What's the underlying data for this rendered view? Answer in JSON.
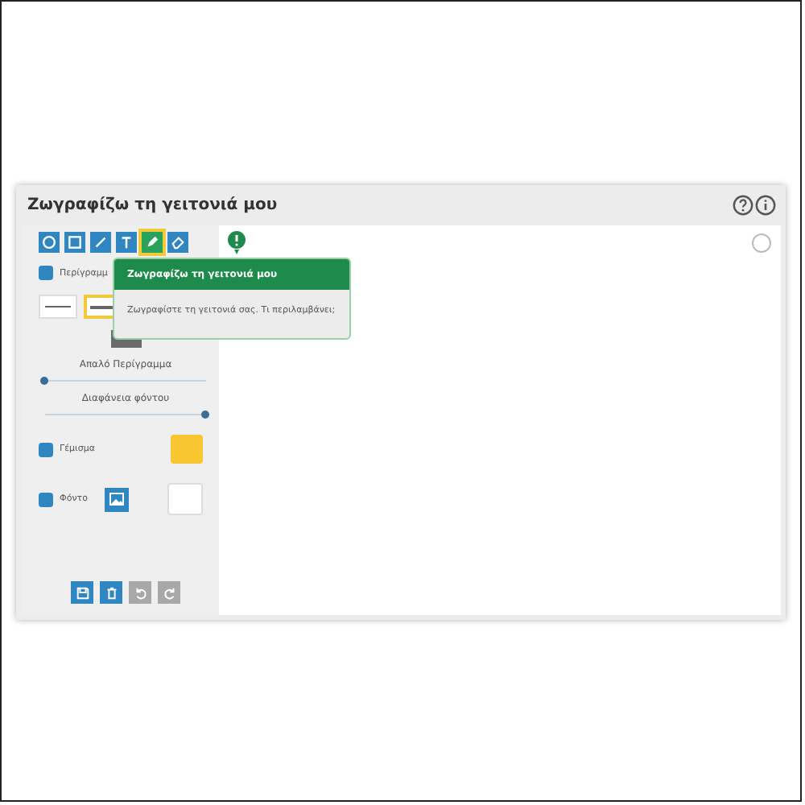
{
  "window": {
    "title": "Ζωγραφίζω τη γειτονιά μου"
  },
  "tools": [
    {
      "kind": "circle",
      "selected": false
    },
    {
      "kind": "square",
      "selected": false
    },
    {
      "kind": "line",
      "selected": false
    },
    {
      "kind": "text",
      "selected": false
    },
    {
      "kind": "pencil",
      "selected": true
    },
    {
      "kind": "eraser",
      "selected": false
    }
  ],
  "outline": {
    "label": "Περίγραμμ",
    "checked": true
  },
  "line_styles": [
    {
      "kind": "thin",
      "selected": false
    },
    {
      "kind": "thick",
      "selected": true
    }
  ],
  "outline_color": {
    "color": "#6b6b6b"
  },
  "sliders": [
    {
      "label": "Απαλό Περίγραμμα",
      "level": 0.0
    },
    {
      "label": "Διαφάνεια φόντου",
      "level": 1.0
    }
  ],
  "fill": {
    "label": "Γέμισμα",
    "checked": true,
    "color": "#f8c630"
  },
  "background": {
    "label": "Φόντο",
    "checked": true,
    "color": "#ffffff"
  },
  "actions": [
    {
      "kind": "save",
      "disabled": false
    },
    {
      "kind": "delete",
      "disabled": false
    },
    {
      "kind": "undo",
      "disabled": true
    },
    {
      "kind": "redo",
      "disabled": true
    }
  ],
  "tooltip": {
    "title": "Ζωγραφίζω τη γειτονιά μου",
    "text": "Ζωγραφίστε τη γειτονιά σας. Τι περιλαμβάνει;"
  }
}
